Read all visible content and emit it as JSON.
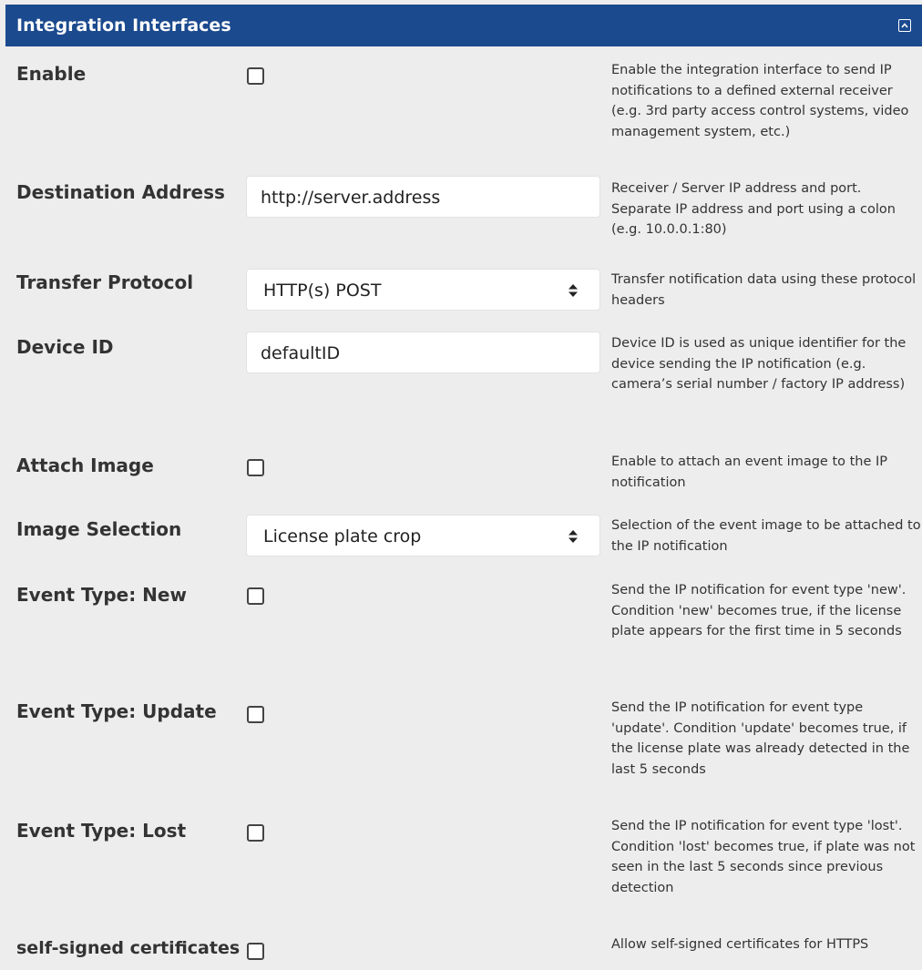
{
  "header": {
    "title": "Integration Interfaces",
    "collapse_icon": "chevron-up-icon",
    "background_color": "#1b4a8e"
  },
  "fields": {
    "enable": {
      "label": "Enable",
      "checked": false,
      "help": "Enable the integration interface to send IP notifications to a defined external receiver (e.g. 3rd party access control systems, video management system, etc.)"
    },
    "destination_address": {
      "label": "Destination Address",
      "value": "http://server.address",
      "help": "Receiver / Server IP address and port. Separate IP address and port using a colon (e.g. 10.0.0.1:80)"
    },
    "transfer_protocol": {
      "label": "Transfer Protocol",
      "selected": "HTTP(s) POST",
      "help": "Transfer notification data using these protocol headers"
    },
    "device_id": {
      "label": "Device ID",
      "value": "defaultID",
      "help": "Device ID is used as unique identifier for the device sending the IP notification (e.g. camera’s serial number / factory IP address)"
    },
    "attach_image": {
      "label": "Attach Image",
      "checked": false,
      "help": "Enable to attach an event image to the IP notification"
    },
    "image_selection": {
      "label": "Image Selection",
      "selected": "License plate crop",
      "help": "Selection of the event image to be attached to the IP notification"
    },
    "event_type_new": {
      "label": "Event Type: New",
      "checked": false,
      "help": "Send the IP notification for event type 'new'. Condition 'new' becomes true, if the license plate appears for the first time in 5 seconds"
    },
    "event_type_update": {
      "label": "Event Type: Update",
      "checked": false,
      "help": "Send the IP notification for event type 'update'. Condition 'update' becomes true, if the license plate was already detected in the last 5 seconds"
    },
    "event_type_lost": {
      "label": "Event Type: Lost",
      "checked": false,
      "help": "Send the IP notification for event type 'lost'. Condition 'lost' becomes true, if plate was not seen in the last 5 seconds since previous detection"
    },
    "self_signed_certificates": {
      "label": "self-signed certificates",
      "checked": false,
      "help": "Allow self-signed certificates for HTTPS"
    }
  }
}
